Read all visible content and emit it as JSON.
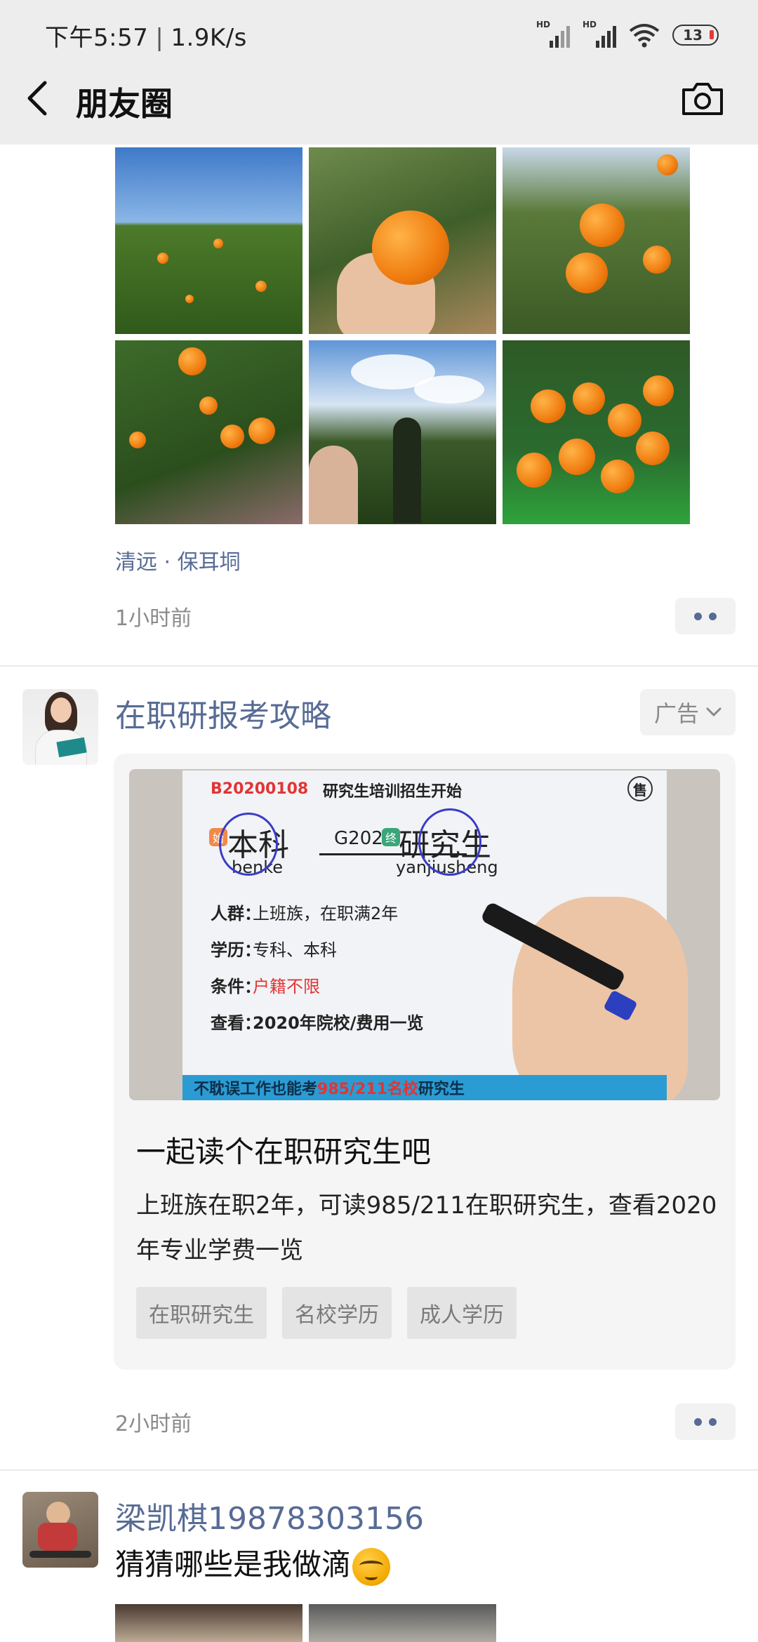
{
  "status_bar": {
    "time": "下午5:57",
    "speed": "1.9K/s",
    "battery": "13"
  },
  "header": {
    "title": "朋友圈"
  },
  "post1": {
    "location": "清远 · 保耳垌",
    "time": "1小时前"
  },
  "ad_post": {
    "name": "在职研报考攻略",
    "ad_label": "广告",
    "image_text": {
      "code": "B20200108",
      "headline": "研究生培训招生开始",
      "sold": "售",
      "start_badge": "始",
      "end_badge": "终",
      "from": "本科",
      "from_pinyin": "benke",
      "year": "G2020",
      "to": "研究生",
      "to_pinyin": "yanjiusheng",
      "row1_label": "人群：",
      "row1_value": "上班族，在职满2年",
      "row2_label": "学历：",
      "row2_value": "专科、本科",
      "row3_label": "条件：",
      "row3_value": "户籍不限",
      "row4_label": "查看：",
      "row4_value": "2020年院校/费用一览",
      "banner_a": "不耽误工作也能考",
      "banner_b": "985/211名校",
      "banner_c": "研究生"
    },
    "title": "一起读个在职研究生吧",
    "description": "上班族在职2年，可读985/211在职研究生，查看2020年专业学费一览",
    "tags": [
      "在职研究生",
      "名校学历",
      "成人学历"
    ],
    "time": "2小时前"
  },
  "post3": {
    "name": "梁凯棋19878303156",
    "text": "猜猜哪些是我做滴"
  },
  "colors": {
    "link": "#576b95",
    "header_bg": "#ededed",
    "card_bg": "#f5f5f5"
  }
}
